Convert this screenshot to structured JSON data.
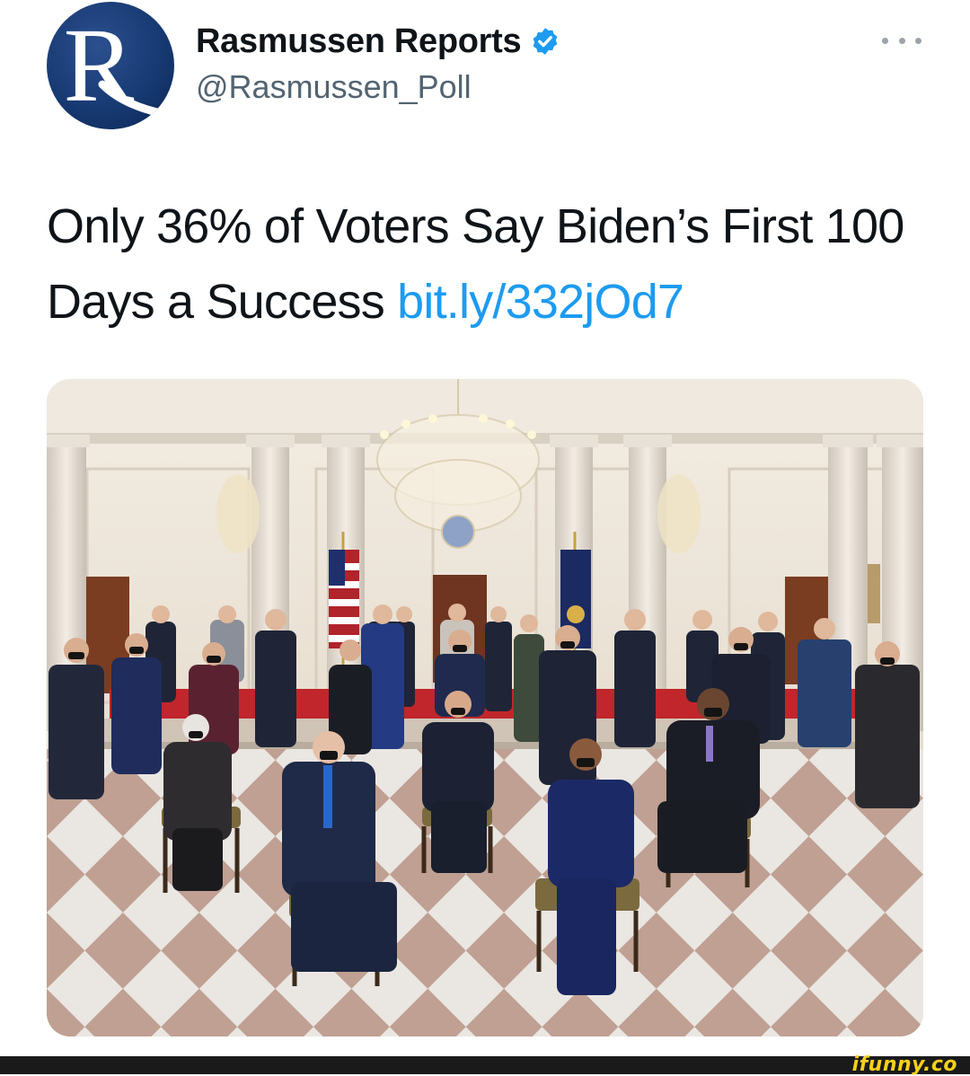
{
  "account": {
    "display_name": "Rasmussen Reports",
    "handle": "@Rasmussen_Poll",
    "avatar_letter": "R",
    "verified": true,
    "avatar_color": "#173a73"
  },
  "tweet": {
    "text_part1": "Only 36% of Voters Say Biden’s First 100 Days a Success",
    "link": "bit.ly/332jOd7",
    "link_color": "#1d9bf0"
  },
  "icons": {
    "verified": "verified-badge-icon",
    "more": "more-options-icon"
  },
  "watermark": "ifunny.co"
}
